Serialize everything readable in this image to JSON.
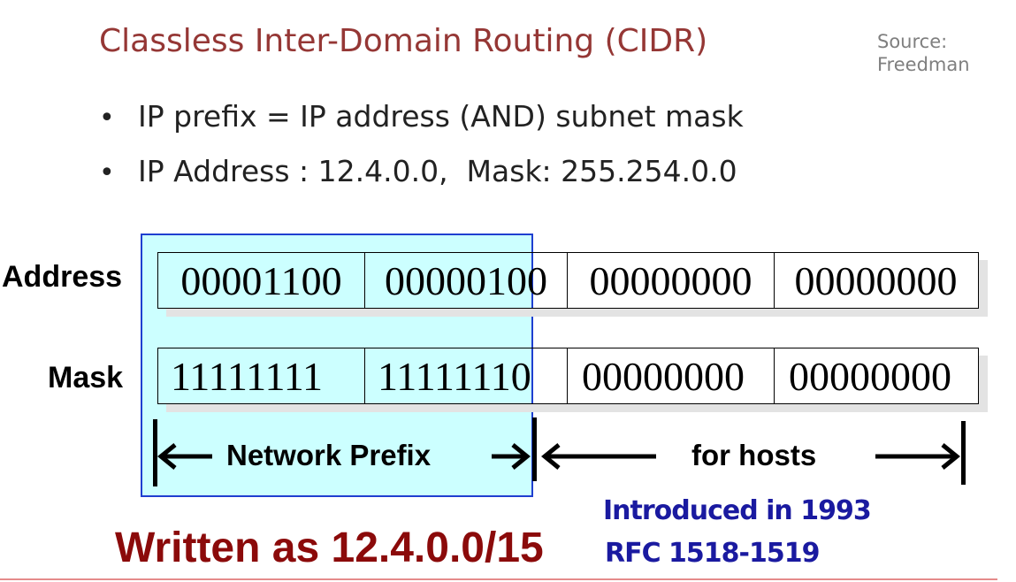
{
  "title": "Classless Inter-Domain Routing (CIDR)",
  "source": {
    "line1": "Source:",
    "line2": "Freedman"
  },
  "bullets": [
    "IP prefix = IP address (AND) subnet mask",
    "IP Address : 12.4.0.0,  Mask: 255.254.0.0"
  ],
  "bullet_glyph": "•",
  "rows": {
    "address": {
      "label": "Address",
      "octets": [
        "00001100",
        "00000100",
        "00000000",
        "00000000"
      ]
    },
    "mask": {
      "label": "Mask",
      "octets": [
        "11111111",
        "11111110",
        "00000000",
        "00000000"
      ]
    }
  },
  "ranges": {
    "network": "Network Prefix",
    "hosts": "for hosts"
  },
  "written_as": "Written as 12.4.0.0/15",
  "notes": {
    "introduced": "Introduced in 1993",
    "rfc": "RFC 1518-1519"
  },
  "colors": {
    "title": "#953735",
    "highlight": "#ccffff",
    "highlight_border": "#1f3fd0",
    "written": "#8b0a0a",
    "notes": "#1a1aa0"
  }
}
